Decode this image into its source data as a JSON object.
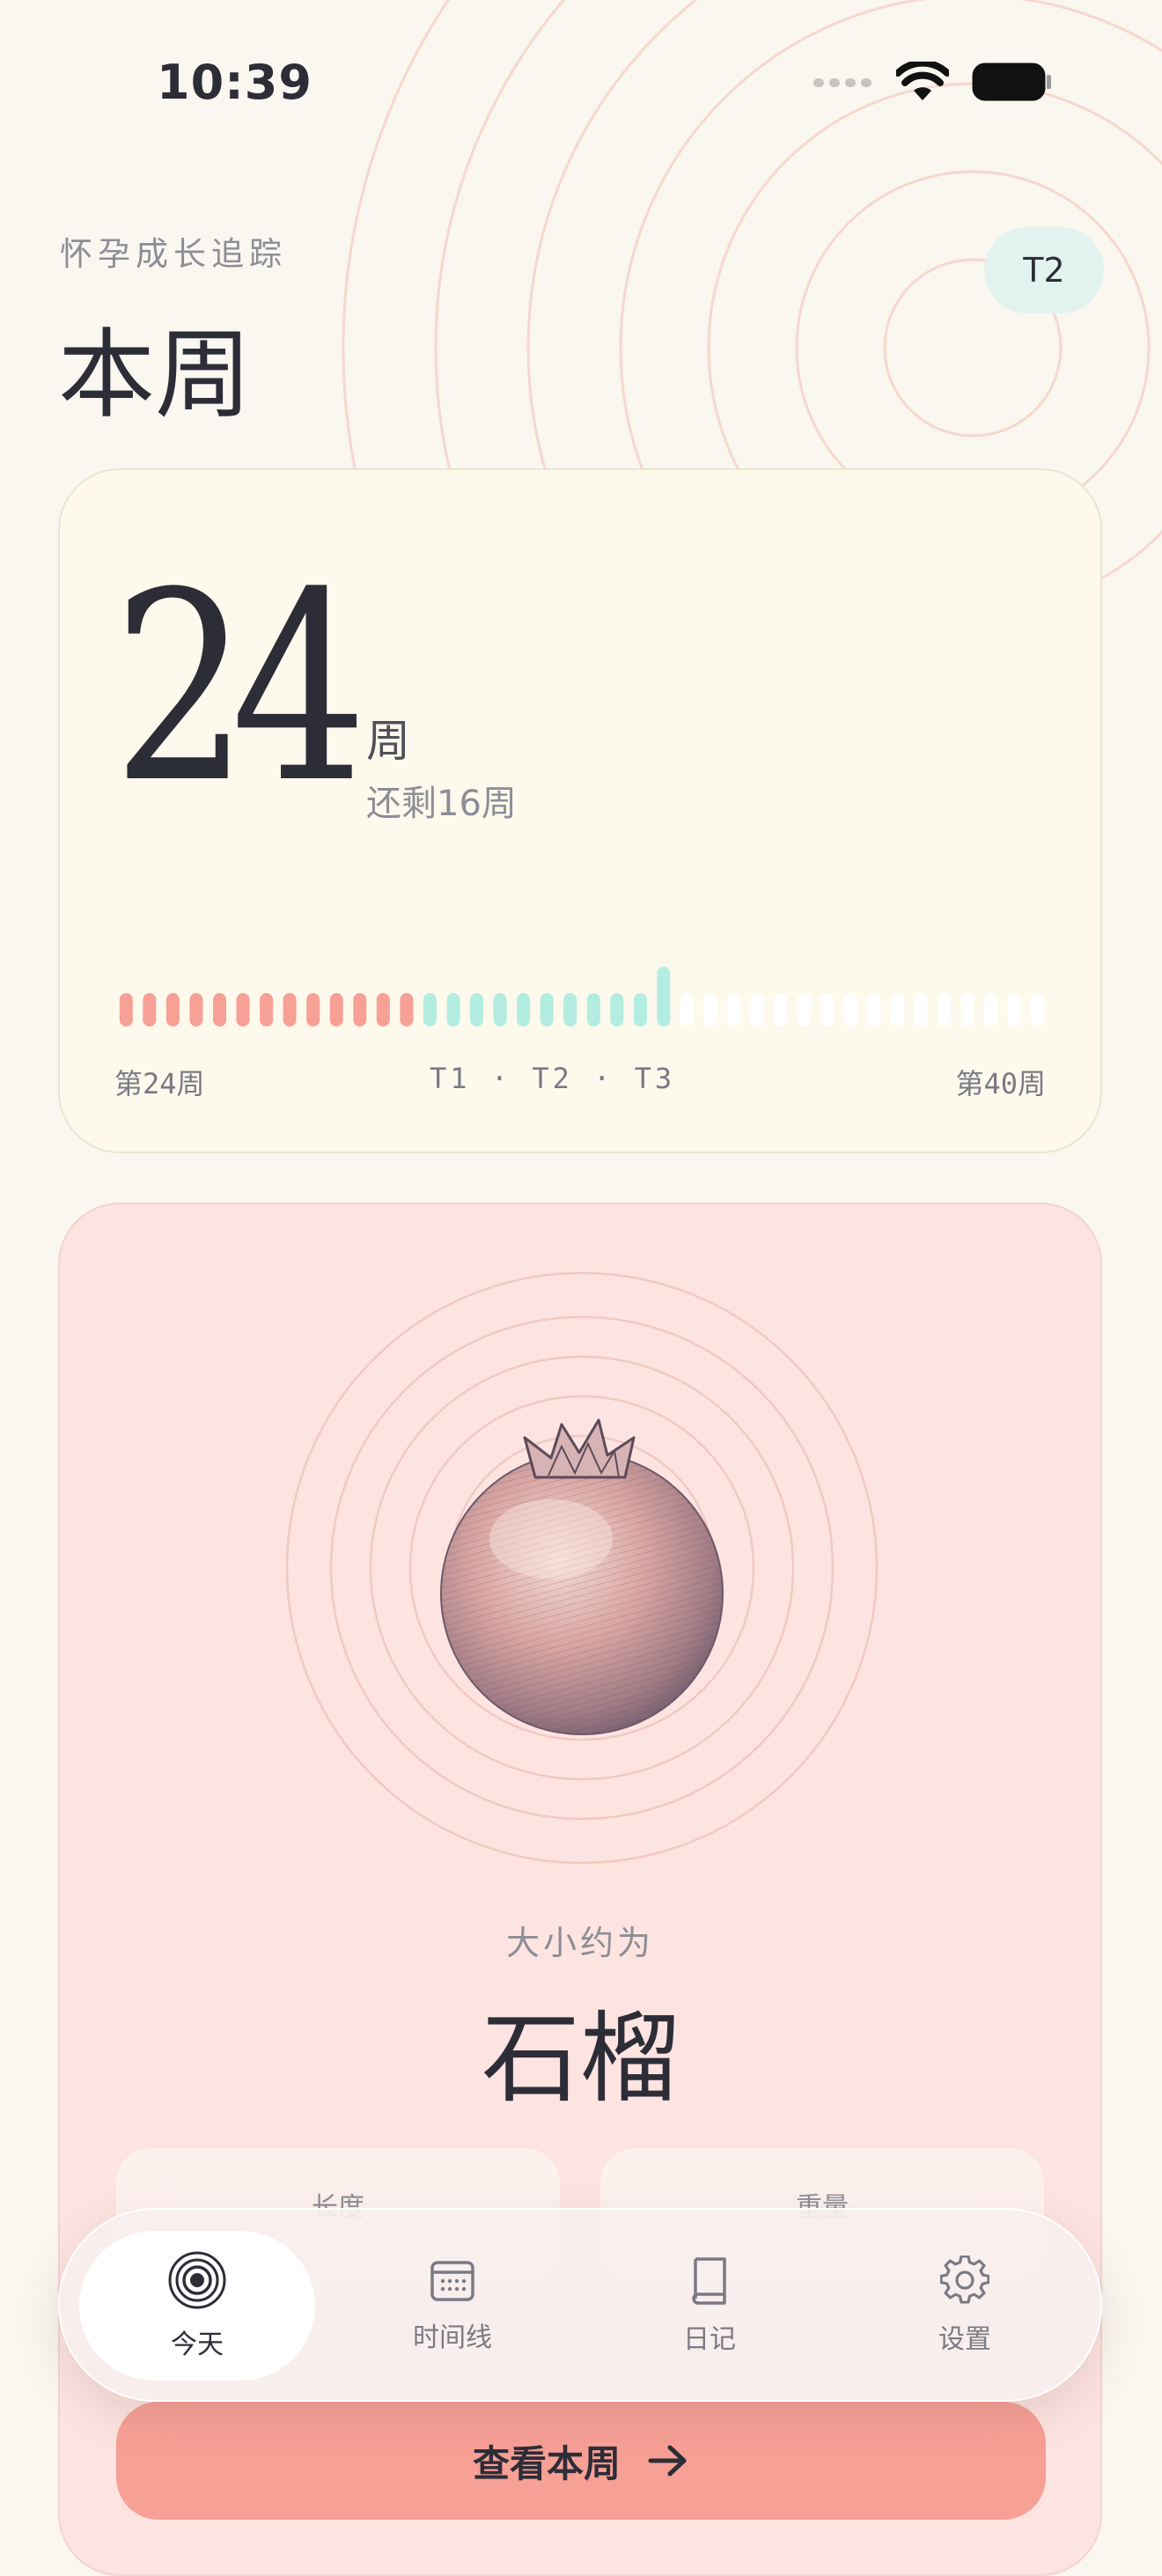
{
  "status": {
    "time": "10:39"
  },
  "header": {
    "subtitle": "怀孕成长追踪",
    "title": "本周",
    "trimester_badge": "T2"
  },
  "week_card": {
    "week": "24",
    "unit": "周",
    "remaining": "还剩16周",
    "progress": {
      "current_week": 24,
      "total_weeks": 40,
      "trimester_week_ranges": [
        [
          1,
          13
        ],
        [
          14,
          27
        ],
        [
          28,
          40
        ]
      ]
    },
    "label_start": "第24周",
    "label_trimesters": "T1 · T2 · T3",
    "label_end": "第40周",
    "colors": {
      "elapsed": "#f7a096",
      "current_trimester": "#b3ece0",
      "future": "#ffffff"
    }
  },
  "fruit_card": {
    "size_label": "大小约为",
    "fruit_name": "石榴",
    "metrics": [
      {
        "label": "长度"
      },
      {
        "label": "重量"
      }
    ],
    "cta_label": "查看本周"
  },
  "tabbar": {
    "items": [
      {
        "label": "今天",
        "icon": "target-icon",
        "active": true
      },
      {
        "label": "时间线",
        "icon": "calendar-icon",
        "active": false
      },
      {
        "label": "日记",
        "icon": "book-icon",
        "active": false
      },
      {
        "label": "设置",
        "icon": "gear-icon",
        "active": false
      }
    ]
  }
}
